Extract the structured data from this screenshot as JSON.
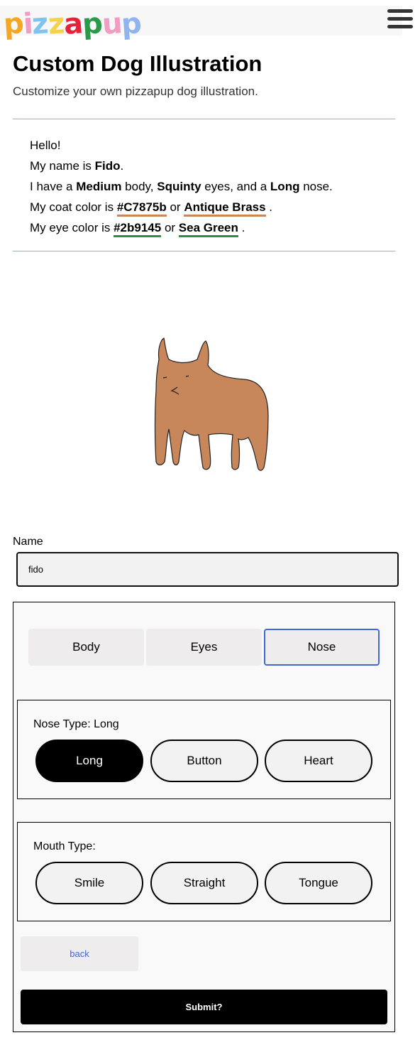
{
  "header": {
    "logo_letters": [
      {
        "char": "p",
        "color": "#f5a623"
      },
      {
        "char": "i",
        "color": "#f29cc4"
      },
      {
        "char": "z",
        "color": "#7fc3f0"
      },
      {
        "char": "z",
        "color": "#f5d24b"
      },
      {
        "char": "a",
        "color": "#e8213a"
      },
      {
        "char": "p",
        "color": "#2a9a4a"
      },
      {
        "char": "u",
        "color": "#f29cc4"
      },
      {
        "char": "p",
        "color": "#8fb4f0"
      }
    ],
    "menu_icon": "hamburger-icon"
  },
  "page": {
    "title": "Custom Dog Illustration",
    "subtitle": "Customize your own pizzapup dog illustration."
  },
  "intro": {
    "hello": "Hello!",
    "name_prefix": "My name is ",
    "name": "Fido",
    "name_suffix": ".",
    "body_prefix": "I have a ",
    "body_type": "Medium",
    "body_mid": " body, ",
    "eye_type": "Squinty",
    "eye_mid": " eyes, and a ",
    "nose_type": "Long",
    "nose_suffix": " nose.",
    "coat_prefix": "My coat color is ",
    "coat_hex": "#C7875b",
    "coat_or": " or ",
    "coat_name": "Antique Brass",
    "coat_suffix": " .",
    "eye_prefix": "My eye color is ",
    "eye_hex": "#2b9145",
    "eye_or": " or ",
    "eye_name": "Sea Green",
    "eye_suffix": " ."
  },
  "colors": {
    "coat": "#c7875b",
    "eye": "#2b9145",
    "accent": "#3e68d9",
    "divider": "#d78be0"
  },
  "form": {
    "name_label": "Name",
    "name_value": "fido",
    "tabs": [
      {
        "label": "Body",
        "active": false
      },
      {
        "label": "Eyes",
        "active": false
      },
      {
        "label": "Nose",
        "active": true
      }
    ],
    "nose_group": {
      "label": "Nose Type: Long",
      "options": [
        "Long",
        "Button",
        "Heart"
      ],
      "selected": "Long"
    },
    "mouth_group": {
      "label": "Mouth Type:",
      "options": [
        "Smile",
        "Straight",
        "Tongue"
      ],
      "selected": ""
    },
    "back_label": "back",
    "submit_label": "Submit?"
  }
}
